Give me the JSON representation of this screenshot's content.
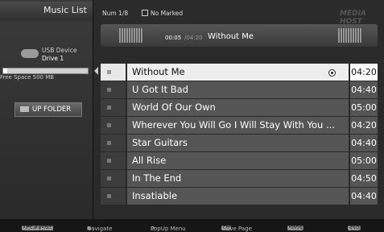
{
  "sidebar": {
    "title": "Music List",
    "device_line1": "USB Device",
    "device_line2": "Drive 1",
    "free_space": "Free Space 500 MB",
    "storage_used_fraction": 0.05,
    "up_folder_label": "UP FOLDER"
  },
  "header": {
    "num": "Num 1/8",
    "marked": "No Marked",
    "brand": "MEDIA HOST"
  },
  "player": {
    "current_time": "00:05",
    "total_time": "04:20",
    "title": "Without Me"
  },
  "tracks": [
    {
      "title": "Without Me",
      "duration": "04:20",
      "selected": true,
      "playing": true
    },
    {
      "title": "U Got It Bad",
      "duration": "04:40"
    },
    {
      "title": "World Of Our Own",
      "duration": "05:00"
    },
    {
      "title": "Wherever You Will Go I Will Stay With You ...",
      "duration": "04:20"
    },
    {
      "title": "Star Guitars",
      "duration": "04:40"
    },
    {
      "title": "All Rise",
      "duration": "05:00"
    },
    {
      "title": "In The End",
      "duration": "04:50"
    },
    {
      "title": "Insatiable",
      "duration": "04:40"
    }
  ],
  "footer": {
    "media_host_key": "MEDIA HOST",
    "media_host": "Media Host",
    "navigate": "Navigate",
    "popup": "PopUp Menu",
    "move_page_key": "CH",
    "move_page": "Move Page",
    "mark_key": "MARK",
    "mark": "Mark",
    "exit_key": "EXIT",
    "exit": "Exit"
  }
}
